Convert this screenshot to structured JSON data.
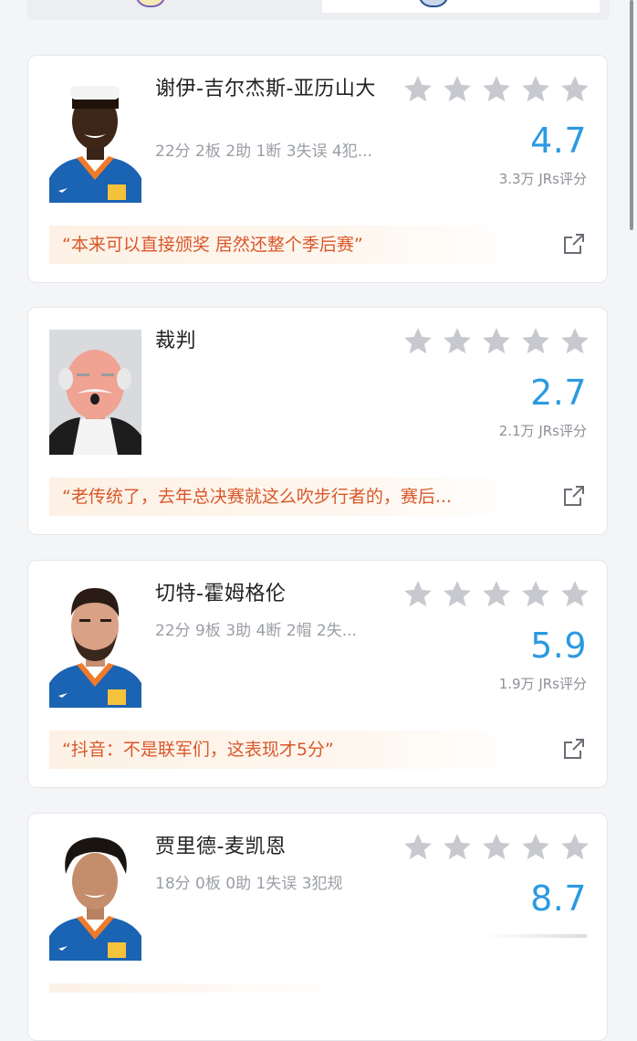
{
  "cards": [
    {
      "name": "谢伊-吉尔杰斯-亚历山大",
      "stats": "22分 2板 2助 1断 3失误 4犯...",
      "rating": "4.7",
      "rating_count": "3.3万 JRs评分",
      "quote": "“本来可以直接颁奖 居然还整个季后赛”",
      "avatar": "player-sga-photo"
    },
    {
      "name": "裁判",
      "stats": "",
      "rating": "2.7",
      "rating_count": "2.1万 JRs评分",
      "quote": "“老传统了，去年总决赛就这么吹步行者的，赛后...",
      "avatar": "referee-illustration"
    },
    {
      "name": "切特-霍姆格伦",
      "stats": "22分 9板 3助 4断 2帽 2失...",
      "rating": "5.9",
      "rating_count": "1.9万 JRs评分",
      "quote": "“抖音：不是联军们，这表现才5分”",
      "avatar": "player-holmgren-photo"
    },
    {
      "name": "贾里德-麦凯恩",
      "stats": "18分 0板 0助 1失误 3犯规",
      "rating": "8.7",
      "rating_count": "",
      "quote": "",
      "avatar": "player-mccain-photo"
    }
  ],
  "colors": {
    "rating_blue": "#2b9ae0",
    "quote_orange": "#d9582b",
    "star_gray": "#c7c9ce",
    "jersey_blue": "#1b63b3",
    "jersey_orange": "#ef7b2a"
  }
}
